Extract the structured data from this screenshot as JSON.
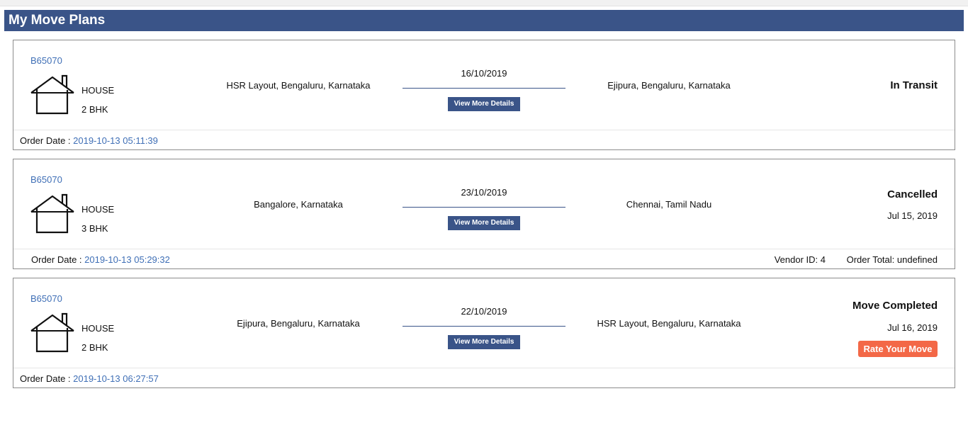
{
  "page": {
    "title": "My Move Plans"
  },
  "plans": [
    {
      "booking_id": "B65070",
      "property_type": "HOUSE",
      "property_size": "2 BHK",
      "from": "HSR Layout, Bengaluru, Karnataka",
      "to": "Ejipura, Bengaluru, Karnataka",
      "move_date": "16/10/2019",
      "details_label": "View More Details",
      "status": "In Transit",
      "order_date_label": "Order Date : ",
      "order_date": "2019-10-13 05:11:39"
    },
    {
      "booking_id": "B65070",
      "property_type": "HOUSE",
      "property_size": "3 BHK",
      "from": "Bangalore, Karnataka",
      "to": "Chennai, Tamil Nadu",
      "move_date": "23/10/2019",
      "details_label": "View More Details",
      "status": "Cancelled",
      "status_date": "Jul 15, 2019",
      "order_date_label": "Order Date : ",
      "order_date": "2019-10-13 05:29:32",
      "vendor_label": "Vendor ID: 4",
      "order_total_label": "Order Total: undefined"
    },
    {
      "booking_id": "B65070",
      "property_type": "HOUSE",
      "property_size": "2 BHK",
      "from": "Ejipura, Bengaluru, Karnataka",
      "to": "HSR Layout, Bengaluru, Karnataka",
      "move_date": "22/10/2019",
      "details_label": "View More Details",
      "status": "Move Completed",
      "status_date": "Jul 16, 2019",
      "rate_label": "Rate Your Move",
      "order_date_label": "Order Date : ",
      "order_date": "2019-10-13 06:27:57"
    }
  ],
  "colors": {
    "header": "#3a5488",
    "link": "#3f6fb6",
    "rate_button": "#f36847"
  },
  "icons": {
    "property": "house-icon"
  }
}
